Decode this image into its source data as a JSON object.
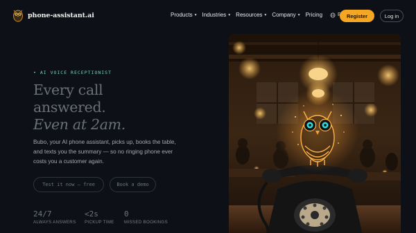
{
  "brand": {
    "name": "phone-assistant.ai"
  },
  "nav": {
    "items": [
      {
        "label": "Products",
        "has_dropdown": true
      },
      {
        "label": "Industries",
        "has_dropdown": true
      },
      {
        "label": "Resources",
        "has_dropdown": true
      },
      {
        "label": "Company",
        "has_dropdown": true
      },
      {
        "label": "Pricing",
        "has_dropdown": false
      }
    ],
    "language": "EN",
    "register_label": "Register",
    "login_label": "Log in"
  },
  "hero": {
    "eyebrow": "• AI VOICE RECEPTIONIST",
    "headline_line1": "Every call",
    "headline_line2": "answered.",
    "headline_line3": "Even at 2am.",
    "subtext": "Bubo, your AI phone assistant, picks up, books the table, and texts you the summary — so no ringing phone ever costs you a customer again.",
    "cta_primary": "Test it now — free",
    "cta_secondary": "Book a demo",
    "stats": [
      {
        "value": "24/7",
        "label": "ALWAYS ANSWERS"
      },
      {
        "value": "<2s",
        "label": "PICKUP TIME"
      },
      {
        "value": "0",
        "label": "MISSED BOOKINGS"
      }
    ]
  },
  "colors": {
    "background": "#0d1117",
    "accent": "#f5a623",
    "eyebrow": "#7ecfc4"
  }
}
